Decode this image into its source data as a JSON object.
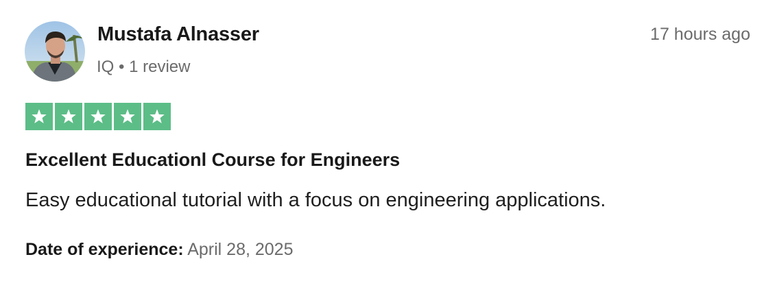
{
  "reviewer": {
    "name": "Mustafa Alnasser",
    "country": "IQ",
    "separator": "•",
    "review_count": "1 review"
  },
  "timestamp": "17 hours ago",
  "rating": {
    "stars": 5,
    "max": 5,
    "color": "#5cbd87"
  },
  "review": {
    "title": "Excellent Educationl Course for Engineers",
    "body": "Easy educational tutorial with a focus on engineering applications."
  },
  "experience": {
    "label": "Date of experience:",
    "date": "April 28, 2025"
  }
}
